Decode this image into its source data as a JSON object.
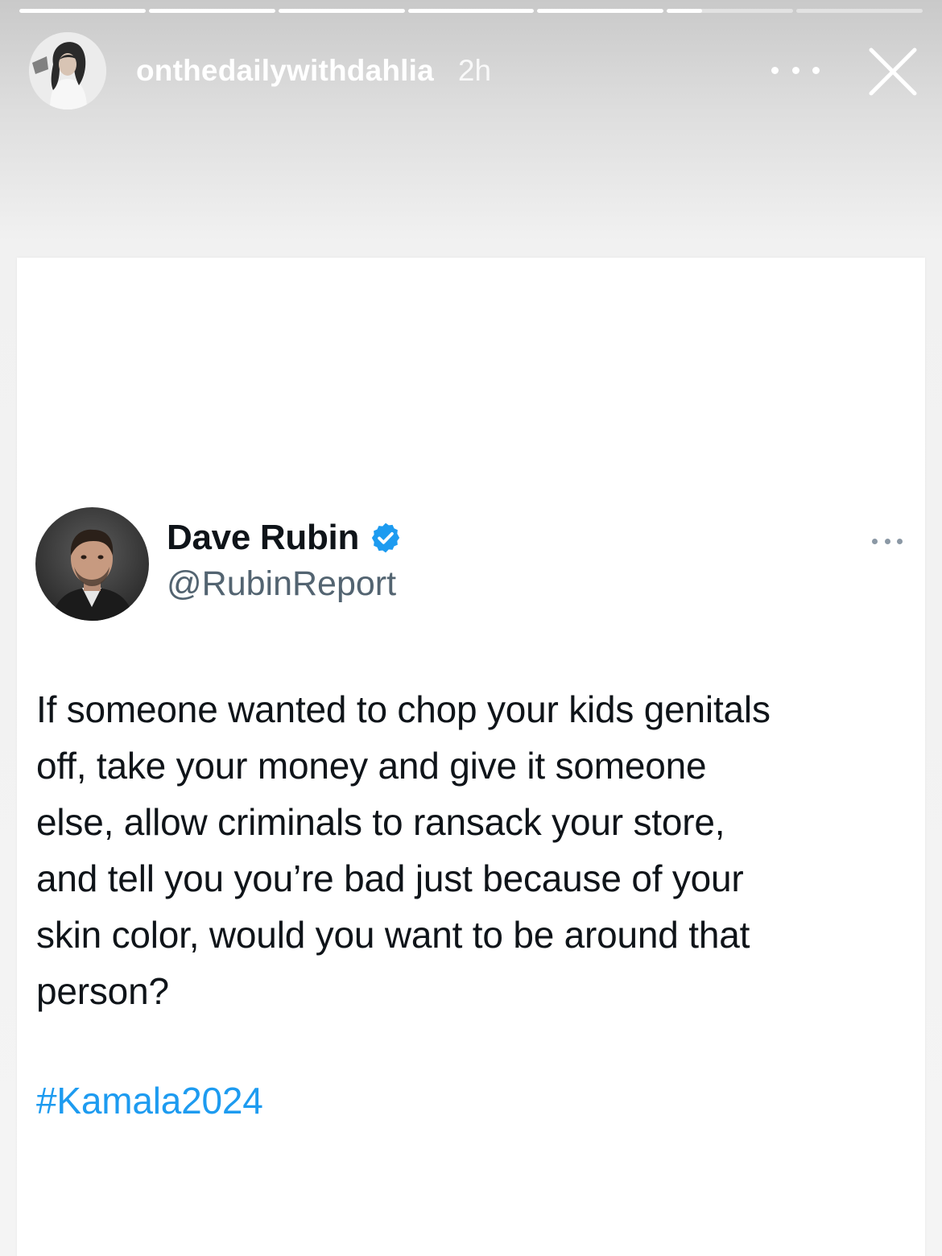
{
  "story": {
    "progress": {
      "segment_count": 7,
      "current_index": 5,
      "current_fraction": 0.28
    },
    "username": "onthedailywithdahlia",
    "time_ago": "2h",
    "icons": {
      "more": "more-horizontal-icon",
      "close": "close-icon"
    }
  },
  "tweet": {
    "display_name": "Dave Rubin",
    "handle": "@RubinReport",
    "verified": true,
    "text": "If someone wanted to chop your kids genitals\noff, take your money and give it someone\nelse, allow criminals to ransack your store,\nand tell you you’re bad just because of your\nskin color, would you want to be around that\nperson?",
    "hashtag": "#Kamala2024"
  },
  "colors": {
    "verified_badge": "#1d9bf0",
    "hashtag": "#1d9bf0",
    "tweet_text": "#0f1419",
    "handle": "#536471"
  }
}
